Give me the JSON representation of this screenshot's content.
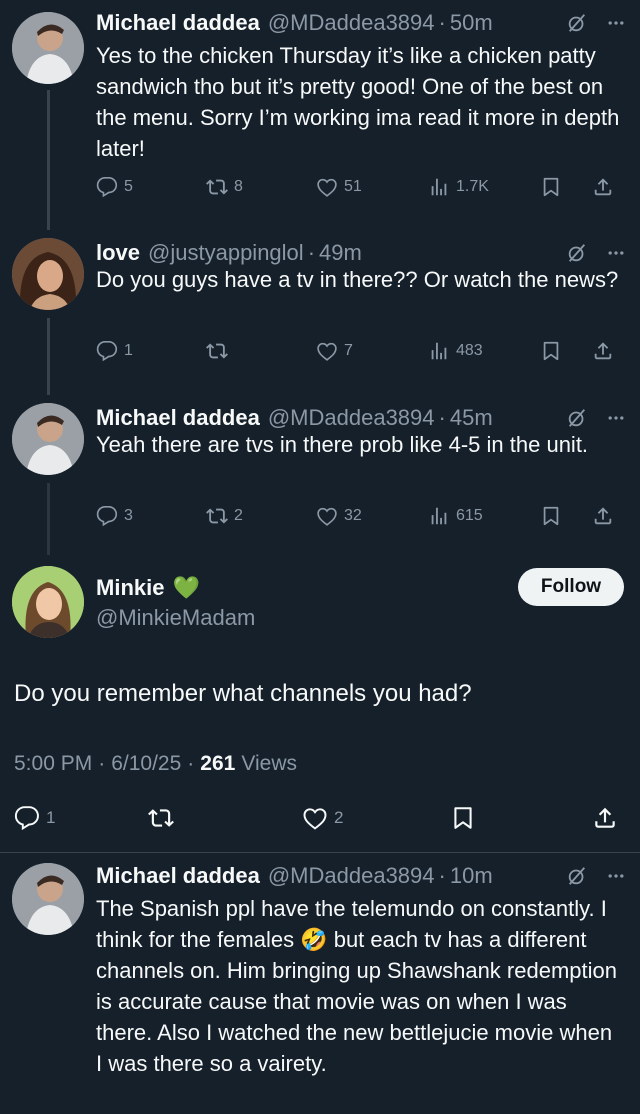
{
  "tweets": [
    {
      "name": "Michael daddea",
      "handle": "@MDaddea3894",
      "time": "50m",
      "text": "Yes to the chicken Thursday it’s like a chicken patty sandwich tho but it’s pretty good! One of the best on the menu. Sorry I’m working ima read it more in depth later!",
      "replies": "5",
      "retweets": "8",
      "likes": "51",
      "views": "1.7K"
    },
    {
      "name": "love",
      "handle": "@justyappinglol",
      "time": "49m",
      "text": "Do you guys have a tv in there?? Or watch the news?",
      "replies": "1",
      "retweets": "",
      "likes": "7",
      "views": "483"
    },
    {
      "name": "Michael daddea",
      "handle": "@MDaddea3894",
      "time": "45m",
      "text": "Yeah there are tvs in there prob like 4-5 in the unit.",
      "replies": "3",
      "retweets": "2",
      "likes": "32",
      "views": "615"
    }
  ],
  "focused": {
    "name": "Minkie",
    "name_emoji": "💚",
    "handle": "@MinkieMadam",
    "follow_label": "Follow",
    "text": "Do you remember what channels you had?",
    "time": "5:00 PM",
    "date": "6/10/25",
    "views_count": "261",
    "views_label": "Views",
    "replies": "1",
    "retweets": "",
    "likes": "2"
  },
  "reply": {
    "name": "Michael daddea",
    "handle": "@MDaddea3894",
    "time": "10m",
    "text": "The Spanish ppl have the telemundo on constantly. I think for the females 🤣 but each tv has a different channels on. Him bringing up Shawshank redemption is accurate cause that movie was on when I was there. Also I watched the new bettlejucie movie when I was there so a vairety."
  },
  "separator": "·",
  "icons": [
    "grok-icon",
    "more-icon",
    "reply-icon",
    "retweet-icon",
    "like-icon",
    "views-icon",
    "bookmark-icon",
    "share-icon"
  ],
  "colors": {
    "background": "#15202b",
    "text": "#f7f9f9",
    "muted": "#8b98a5",
    "line": "#38444d"
  }
}
